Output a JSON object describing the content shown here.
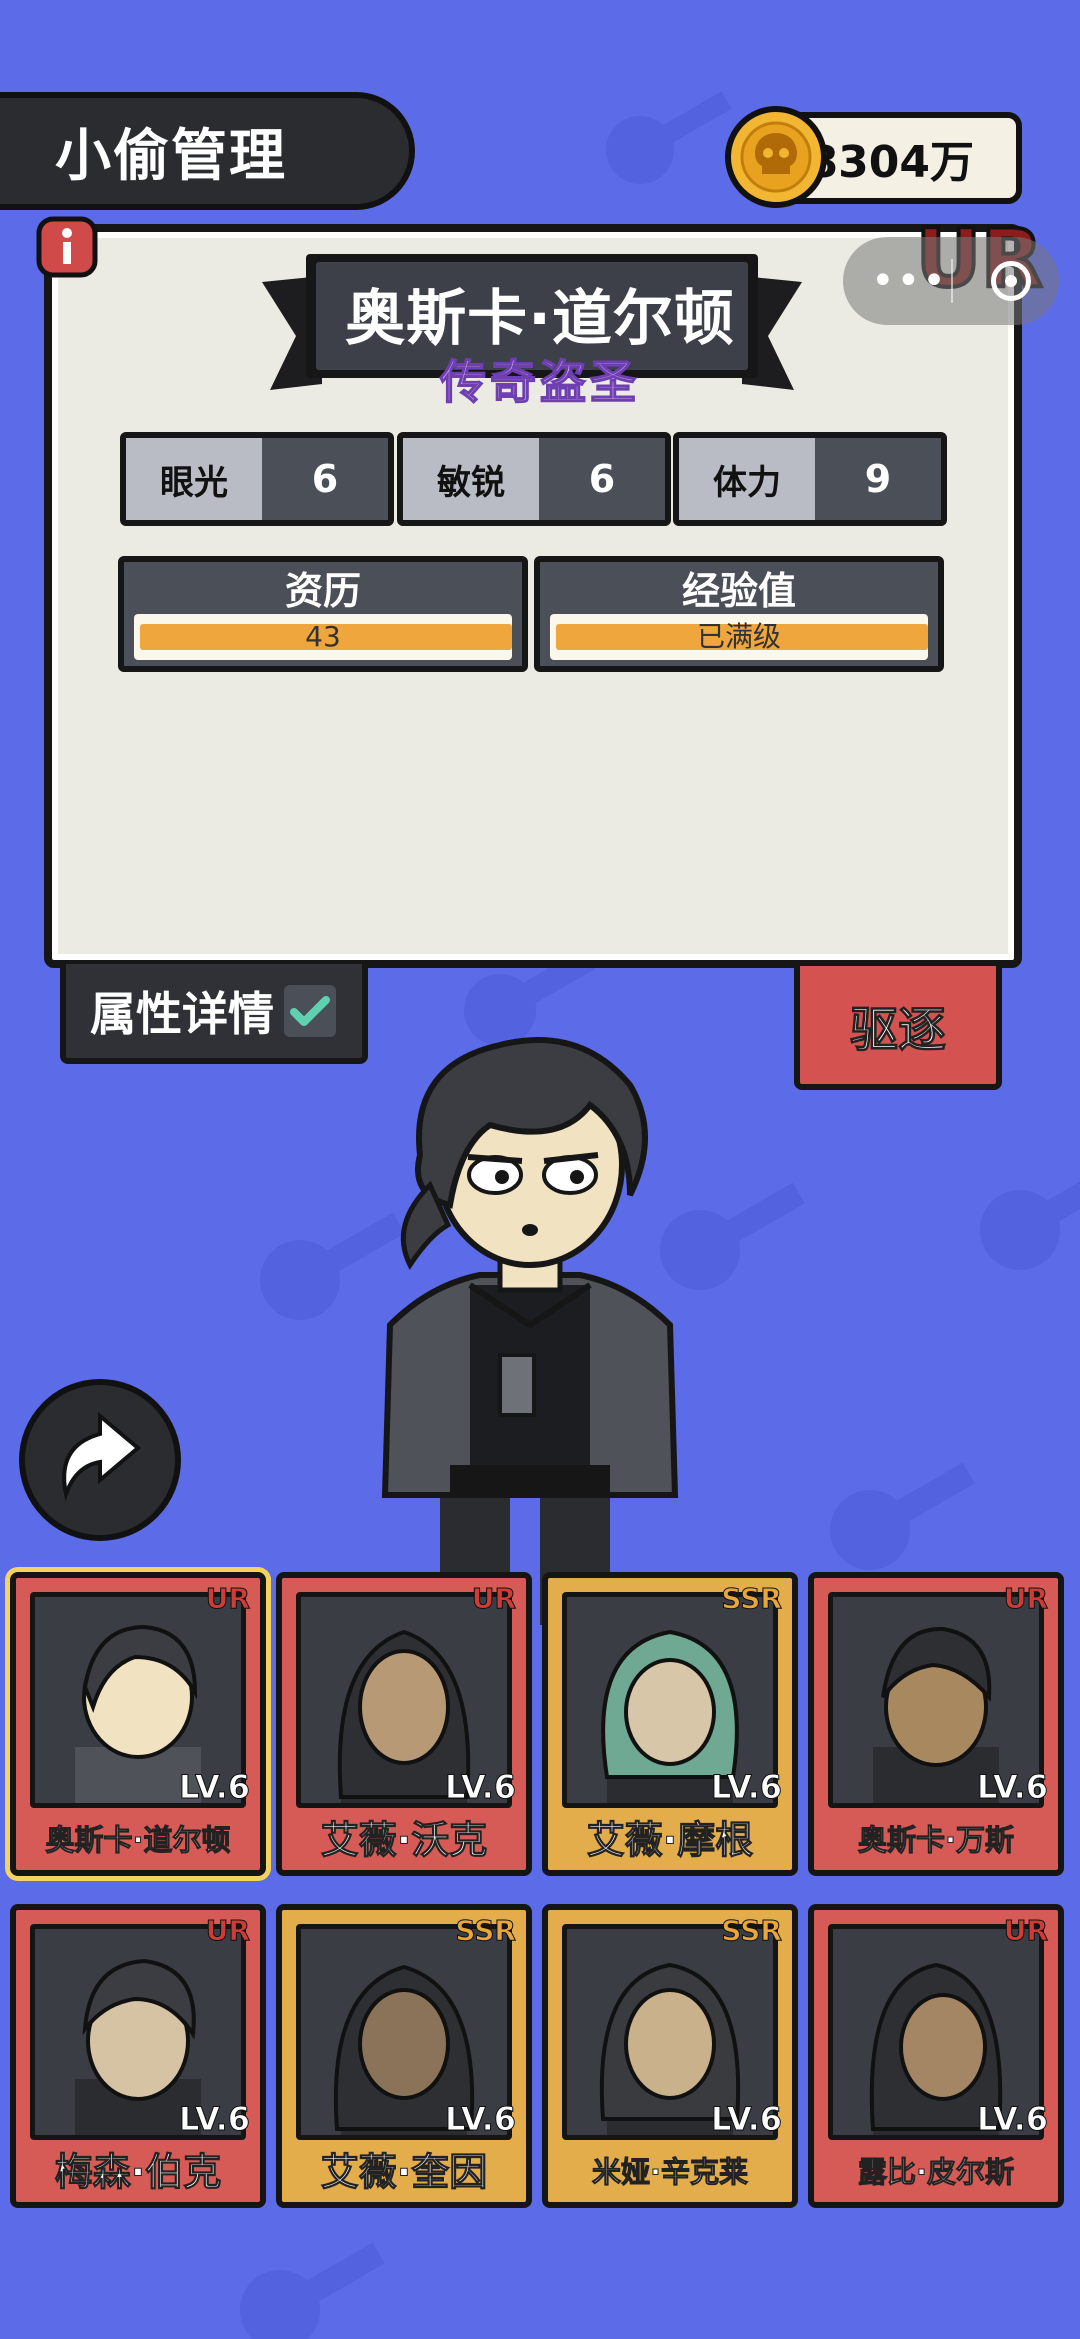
{
  "header": {
    "title": "小偷管理"
  },
  "currency": {
    "amount": "8304万",
    "icon": "skull-coin-icon"
  },
  "detail": {
    "rarity": "UR",
    "name": "奥斯卡·道尔顿",
    "title": "传奇盗圣",
    "stats": [
      {
        "label": "眼光",
        "value": "6"
      },
      {
        "label": "敏锐",
        "value": "6"
      },
      {
        "label": "体力",
        "value": "9"
      }
    ],
    "experience_label": "资历",
    "experience_value": "43",
    "exp_label": "经验值",
    "exp_value": "已满级"
  },
  "actions": {
    "detail_label": "属性详情",
    "expel_label": "驱逐"
  },
  "roster": [
    {
      "name": "奥斯卡·道尔顿",
      "rarity": "UR",
      "level": "LV.6",
      "selected": true
    },
    {
      "name": "艾薇·沃克",
      "rarity": "UR",
      "level": "LV.6"
    },
    {
      "name": "艾薇·摩根",
      "rarity": "SSR",
      "level": "LV.6"
    },
    {
      "name": "奥斯卡·万斯",
      "rarity": "UR",
      "level": "LV.6"
    },
    {
      "name": "梅森·伯克",
      "rarity": "UR",
      "level": "LV.6"
    },
    {
      "name": "艾薇·奎因",
      "rarity": "SSR",
      "level": "LV.6"
    },
    {
      "name": "米娅·辛克莱",
      "rarity": "SSR",
      "level": "LV.6"
    },
    {
      "name": "露比·皮尔斯",
      "rarity": "UR",
      "level": "LV.6"
    }
  ],
  "colors": {
    "background": "#5c6be8",
    "ur_card": "#d65a55",
    "ssr_card": "#e3ad4c",
    "bar_fill": "#efa63d"
  }
}
